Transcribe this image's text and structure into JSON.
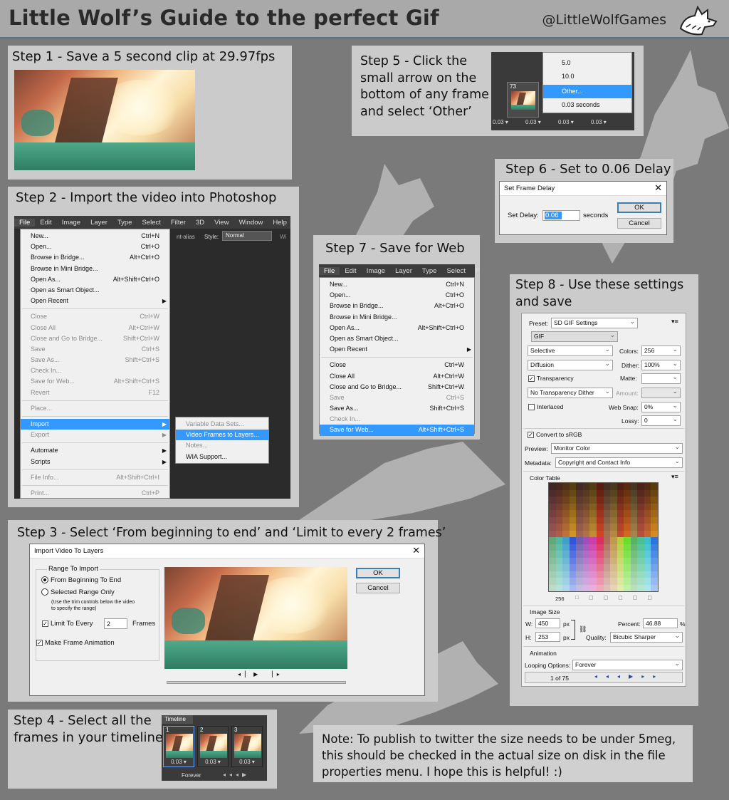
{
  "header": {
    "title": "Little Wolf’s Guide to the perfect Gif",
    "handle": "@LittleWolfGames"
  },
  "step1": {
    "title": "Step 1 - Save a 5 second clip at 29.97fps"
  },
  "step2": {
    "title": "Step 2 - Import the video into Photoshop",
    "menubar": [
      "File",
      "Edit",
      "Image",
      "Layer",
      "Type",
      "Select",
      "Filter",
      "3D",
      "View",
      "Window",
      "Help"
    ],
    "options_bar": {
      "anti_alias": "nt-alias",
      "style_label": "Style:",
      "style_value": "Normal",
      "extra": "Wi"
    },
    "file_menu": [
      {
        "label": "New...",
        "shortcut": "Ctrl+N"
      },
      {
        "label": "Open...",
        "shortcut": "Ctrl+O"
      },
      {
        "label": "Browse in Bridge...",
        "shortcut": "Alt+Ctrl+O"
      },
      {
        "label": "Browse in Mini Bridge...",
        "shortcut": ""
      },
      {
        "label": "Open As...",
        "shortcut": "Alt+Shift+Ctrl+O"
      },
      {
        "label": "Open as Smart Object...",
        "shortcut": ""
      },
      {
        "label": "Open Recent",
        "shortcut": "",
        "arrow": true
      },
      {
        "sep": true
      },
      {
        "label": "Close",
        "shortcut": "Ctrl+W",
        "dis": true
      },
      {
        "label": "Close All",
        "shortcut": "Alt+Ctrl+W",
        "dis": true
      },
      {
        "label": "Close and Go to Bridge...",
        "shortcut": "Shift+Ctrl+W",
        "dis": true
      },
      {
        "label": "Save",
        "shortcut": "Ctrl+S",
        "dis": true
      },
      {
        "label": "Save As...",
        "shortcut": "Shift+Ctrl+S",
        "dis": true
      },
      {
        "label": "Check In...",
        "shortcut": "",
        "dis": true
      },
      {
        "label": "Save for Web...",
        "shortcut": "Alt+Shift+Ctrl+S",
        "dis": true
      },
      {
        "label": "Revert",
        "shortcut": "F12",
        "dis": true
      },
      {
        "sep": true
      },
      {
        "label": "Place...",
        "shortcut": "",
        "dis": true
      },
      {
        "sep": true
      },
      {
        "label": "Import",
        "shortcut": "",
        "arrow": true,
        "hl": true
      },
      {
        "label": "Export",
        "shortcut": "",
        "arrow": true,
        "dis": true
      },
      {
        "sep": true
      },
      {
        "label": "Automate",
        "shortcut": "",
        "arrow": true
      },
      {
        "label": "Scripts",
        "shortcut": "",
        "arrow": true
      },
      {
        "sep": true
      },
      {
        "label": "File Info...",
        "shortcut": "Alt+Shift+Ctrl+I",
        "dis": true
      },
      {
        "sep": true
      },
      {
        "label": "Print...",
        "shortcut": "Ctrl+P",
        "dis": true
      }
    ],
    "import_submenu": [
      {
        "label": "Variable Data Sets...",
        "dis": true
      },
      {
        "label": "Video Frames to Layers...",
        "hl": true
      },
      {
        "label": "Notes...",
        "dis": true
      },
      {
        "label": "WIA Support..."
      }
    ]
  },
  "step3": {
    "title": "Step 3 - Select ‘From beginning to end’ and ‘Limit to every 2 frames’",
    "dialog_title": "Import Video To Layers",
    "range_group": "Range To Import",
    "opt_begin": "From Beginning To End",
    "opt_selected": "Selected Range Only",
    "hint": "(Use the trim controls below the video to specify the range)",
    "limit_label": "Limit To Every",
    "limit_value": "2",
    "frames_label": "Frames",
    "make_anim": "Make Frame Animation",
    "ok": "OK",
    "cancel": "Cancel"
  },
  "step4": {
    "title": "Step 4 - Select all the frames in your timeline",
    "tab": "Timeline",
    "frames": [
      {
        "num": "1",
        "delay": "0.03"
      },
      {
        "num": "2",
        "delay": "0.03"
      },
      {
        "num": "3",
        "delay": "0.03"
      }
    ],
    "loop": "Forever"
  },
  "step5": {
    "title": "Step 5 - Click the small arrow on the bottom of any frame and select ‘Other’",
    "menu": [
      "5.0",
      "10.0",
      "Other...",
      "0.03 seconds"
    ],
    "frame_num": "73",
    "delays": [
      "0.03",
      "0.03",
      "0.03",
      "0.03"
    ]
  },
  "step6": {
    "title": "Step 6 - Set to 0.06 Delay",
    "dialog_title": "Set Frame Delay",
    "label": "Set Delay:",
    "value": "0.06",
    "unit": "seconds",
    "ok": "OK",
    "cancel": "Cancel"
  },
  "step7": {
    "title": "Step 7 - Save for Web",
    "menubar": [
      "File",
      "Edit",
      "Image",
      "Layer",
      "Type",
      "Select",
      "F"
    ],
    "menu": [
      {
        "label": "New...",
        "shortcut": "Ctrl+N"
      },
      {
        "label": "Open...",
        "shortcut": "Ctrl+O"
      },
      {
        "label": "Browse in Bridge...",
        "shortcut": "Alt+Ctrl+O"
      },
      {
        "label": "Browse in Mini Bridge...",
        "shortcut": ""
      },
      {
        "label": "Open As...",
        "shortcut": "Alt+Shift+Ctrl+O"
      },
      {
        "label": "Open as Smart Object...",
        "shortcut": ""
      },
      {
        "label": "Open Recent",
        "shortcut": "",
        "arrow": true
      },
      {
        "sep": true
      },
      {
        "label": "Close",
        "shortcut": "Ctrl+W"
      },
      {
        "label": "Close All",
        "shortcut": "Alt+Ctrl+W"
      },
      {
        "label": "Close and Go to Bridge...",
        "shortcut": "Shift+Ctrl+W"
      },
      {
        "label": "Save",
        "shortcut": "Ctrl+S",
        "dis": true
      },
      {
        "label": "Save As...",
        "shortcut": "Shift+Ctrl+S"
      },
      {
        "label": "Check In...",
        "shortcut": "",
        "dis": true
      },
      {
        "label": "Save for Web...",
        "shortcut": "Alt+Shift+Ctrl+S",
        "hl": true
      }
    ]
  },
  "step8": {
    "title": "Step 8 - Use these settings and save",
    "preset_label": "Preset:",
    "preset": "SD GIF Settings",
    "format": "GIF",
    "reduction": "Selective",
    "colors_label": "Colors:",
    "colors": "256",
    "dither_algo": "Diffusion",
    "dither_label": "Dither:",
    "dither": "100%",
    "transparency": "Transparency",
    "matte_label": "Matte:",
    "trans_dither": "No Transparency Dither",
    "amount_label": "Amount:",
    "interlaced": "Interlaced",
    "websnap_label": "Web Snap:",
    "websnap": "0%",
    "lossy_label": "Lossy:",
    "lossy": "0",
    "srgb": "Convert to sRGB",
    "preview_label": "Preview:",
    "preview": "Monitor Color",
    "metadata_label": "Metadata:",
    "metadata": "Copyright and Contact Info",
    "color_table": "Color Table",
    "ct_count": "256",
    "image_size": "Image Size",
    "w_label": "W:",
    "w": "450",
    "h_label": "H:",
    "h": "253",
    "px": "px",
    "percent_label": "Percent:",
    "percent": "46.88",
    "pct": "%",
    "quality_label": "Quality:",
    "quality": "Bicubic Sharper",
    "animation": "Animation",
    "looping_label": "Looping Options:",
    "looping": "Forever",
    "frame_counter": "1 of 75"
  },
  "note": {
    "text": "Note: To publish to twitter the size needs to be under 5meg, this should be checked in the actual size on disk in the file properties menu. I hope this is helpful! :)"
  }
}
